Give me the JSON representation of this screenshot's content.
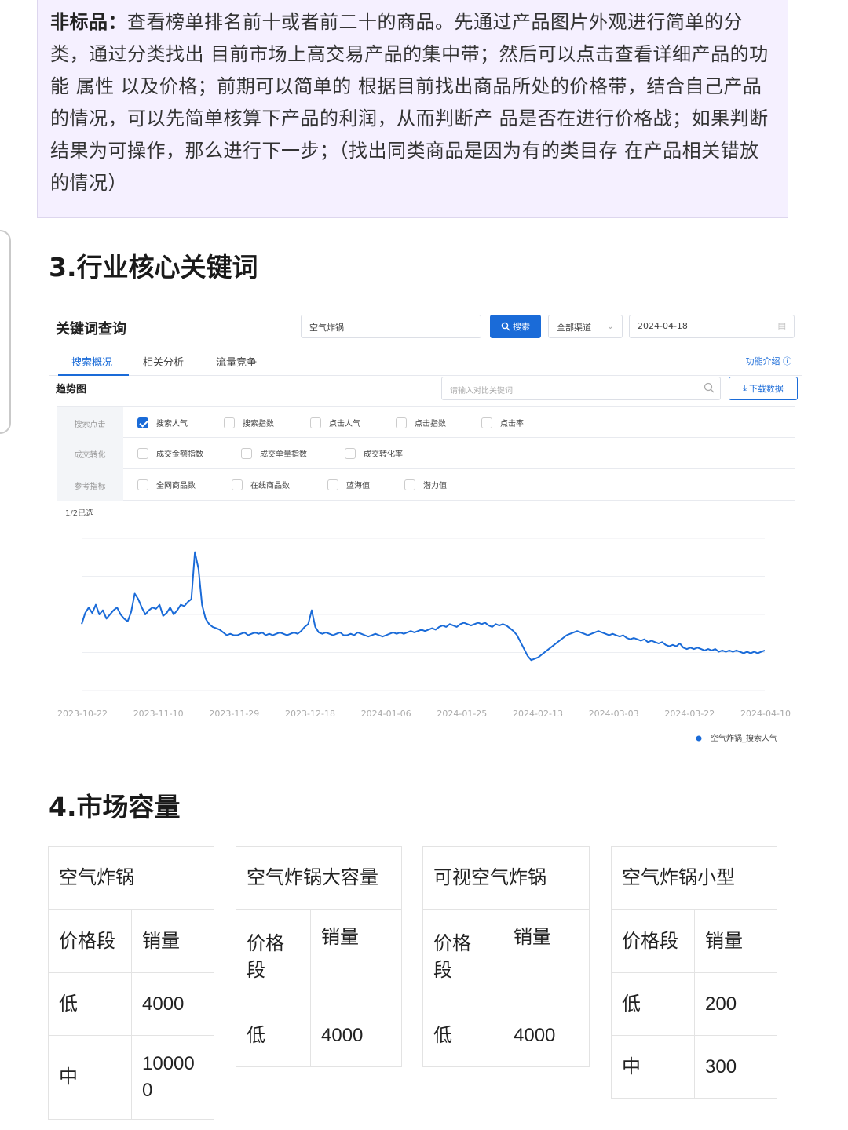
{
  "note": {
    "bold_label": "非标品：",
    "text": "查看榜单排名前十或者前二十的商品。先通过产品图片外观进行简单的分类，通过分类找出 目前市场上高交易产品的集中带；然后可以点击查看详细产品的功能 属性 以及价格；前期可以简单的 根据目前找出商品所处的价格带，结合自己产品的情况，可以先简单核算下产品的利润，从而判断产 品是否在进行价格战；如果判断结果为可操作，那么进行下一步；（找出同类商品是因为有的类目存 在产品相关错放的情况）"
  },
  "section3": {
    "title": "3.行业核心关键词"
  },
  "screenshot": {
    "title": "关键词查询",
    "keyword_value": "空气炸锅",
    "search_label": "搜索",
    "channel_value": "全部渠道",
    "date_value": "2024-04-18",
    "tabs": [
      "搜索概况",
      "相关分析",
      "流量竞争"
    ],
    "func_intro": "功能介绍",
    "trend_label": "趋势图",
    "compare_placeholder": "请输入对比关键词",
    "download_label": "下载数据",
    "filters": [
      {
        "head": "搜索点击",
        "items": [
          "搜索人气",
          "搜索指数",
          "点击人气",
          "点击指数",
          "点击率"
        ]
      },
      {
        "head": "成交转化",
        "items": [
          "成交金额指数",
          "成交单量指数",
          "成交转化率"
        ]
      },
      {
        "head": "参考指标",
        "items": [
          "全网商品数",
          "在线商品数",
          "蓝海值",
          "潜力值"
        ]
      }
    ],
    "selected_count": "1/2已选"
  },
  "chart_data": {
    "type": "line",
    "x_tick_labels": [
      "2023-10-22",
      "2023-11-10",
      "2023-11-29",
      "2023-12-18",
      "2024-01-06",
      "2024-01-25",
      "2024-02-13",
      "2024-03-03",
      "2024-03-22",
      "2024-04-10"
    ],
    "series": [
      {
        "name": "空气炸锅_搜索人气",
        "color": "#1a6bd8",
        "values": [
          48,
          56,
          60,
          56,
          62,
          55,
          58,
          52,
          55,
          58,
          60,
          55,
          52,
          50,
          57,
          70,
          66,
          60,
          55,
          58,
          60,
          59,
          62,
          54,
          56,
          60,
          55,
          58,
          62,
          61,
          64,
          66,
          100,
          88,
          62,
          52,
          48,
          46,
          45,
          44,
          42,
          40,
          41,
          40,
          40,
          41,
          42,
          40,
          41,
          42,
          41,
          42,
          40,
          41,
          40,
          41,
          42,
          41,
          40,
          41,
          42,
          41,
          43,
          46,
          48,
          58,
          46,
          42,
          41,
          42,
          41,
          40,
          41,
          42,
          40,
          40,
          41,
          40,
          42,
          41,
          40,
          39,
          40,
          41,
          40,
          39,
          40,
          41,
          42,
          41,
          42,
          41,
          42,
          43,
          42,
          43,
          44,
          43,
          44,
          45,
          44,
          46,
          47,
          46,
          48,
          47,
          46,
          48,
          49,
          48,
          47,
          48,
          49,
          48,
          49,
          47,
          46,
          48,
          47,
          48,
          47,
          45,
          43,
          40,
          35,
          30,
          25,
          22,
          23,
          24,
          26,
          28,
          30,
          32,
          34,
          36,
          38,
          40,
          41,
          42,
          43,
          42,
          41,
          40,
          41,
          42,
          43,
          42,
          41,
          40,
          41,
          40,
          39,
          40,
          38,
          37,
          38,
          37,
          36,
          37,
          35,
          36,
          35,
          34,
          35,
          33,
          32,
          33,
          32,
          34,
          31,
          30,
          31,
          30,
          31,
          30,
          29,
          30,
          29,
          30,
          28,
          29,
          28,
          29,
          28,
          29,
          28,
          27,
          28,
          27,
          28,
          27,
          28,
          29
        ]
      }
    ],
    "legend": [
      "空气炸锅_搜索人气"
    ],
    "legend_position": "bottom-right",
    "grid": true
  },
  "section4": {
    "title": "4.市场容量"
  },
  "market_tables": [
    {
      "title": "空气炸锅",
      "headers": [
        "价格段",
        "销量"
      ],
      "rows": [
        [
          "低",
          "4000"
        ],
        [
          "中",
          "10000\n0"
        ]
      ]
    },
    {
      "title": "空气炸锅大容量",
      "headers": [
        "价格\n段",
        "销量"
      ],
      "rows": [
        [
          "低",
          "4000"
        ]
      ]
    },
    {
      "title": "可视空气炸锅",
      "headers": [
        "价格\n段",
        "销量"
      ],
      "rows": [
        [
          "低",
          "4000"
        ]
      ]
    },
    {
      "title": "空气炸锅小型",
      "headers": [
        "价格段",
        "销量"
      ],
      "rows": [
        [
          "低",
          "200"
        ],
        [
          "中",
          "300"
        ]
      ]
    }
  ]
}
